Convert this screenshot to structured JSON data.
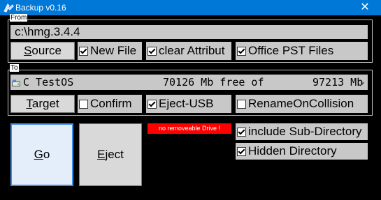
{
  "window": {
    "title": "Backup v0.16",
    "close_glyph": "✕",
    "icon": "backup-app-icon"
  },
  "from_group": {
    "label": "From",
    "path_value": "c:\\hmg.3.4.4",
    "source_button": "Source",
    "new_file": {
      "label": "New File",
      "checked": true
    },
    "clear_attribut": {
      "label": "clear Attribut",
      "checked": true
    },
    "office_pst": {
      "label": "Office PST Files",
      "checked": true
    }
  },
  "to_group": {
    "label": "To",
    "drive": {
      "name": "C TestOS",
      "free": "70126 Mb free of",
      "total": "97213 Mb",
      "chevron": "⌄",
      "icon": "drive-icon"
    },
    "target_button": "Target",
    "confirm": {
      "label": "Confirm",
      "checked": false
    },
    "eject_usb": {
      "label": "Eject-USB",
      "checked": true
    },
    "rename_on_collision": {
      "label": "RenameOnCollision",
      "checked": false
    }
  },
  "actions": {
    "go_button": "Go",
    "eject_button": "Eject"
  },
  "status": {
    "alert_text": "no removeable Drive !",
    "alert_color": "#ff0000"
  },
  "options": {
    "include_subdir": {
      "label": "include Sub-Directory",
      "checked": true
    },
    "hidden_dir": {
      "label": "Hidden Directory",
      "checked": true
    }
  }
}
